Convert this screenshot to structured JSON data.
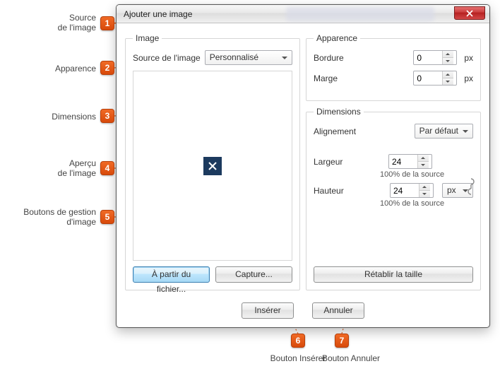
{
  "dialog": {
    "title": "Ajouter une image",
    "image_group": {
      "legend": "Image",
      "source_label": "Source de l'image",
      "source_value": "Personnalisé",
      "from_file_btn": "À partir du fichier...",
      "capture_btn": "Capture..."
    },
    "appearance_group": {
      "legend": "Apparence",
      "border_label": "Bordure",
      "border_value": "0",
      "margin_label": "Marge",
      "margin_value": "0",
      "unit": "px"
    },
    "dimensions_group": {
      "legend": "Dimensions",
      "align_label": "Alignement",
      "align_value": "Par défaut",
      "width_label": "Largeur",
      "width_value": "24",
      "height_label": "Hauteur",
      "height_value": "24",
      "height_unit": "px",
      "pct_text": "100% de la source",
      "reset_btn": "Rétablir la taille"
    },
    "footer": {
      "insert": "Insérer",
      "cancel": "Annuler"
    }
  },
  "annotations": {
    "1": "Source\nde l'image",
    "2": "Apparence",
    "3": "Dimensions",
    "4": "Aperçu\nde l'image",
    "5": "Boutons de gestion\nd'image",
    "6": "Bouton Insérer",
    "7": "Bouton Annuler"
  }
}
